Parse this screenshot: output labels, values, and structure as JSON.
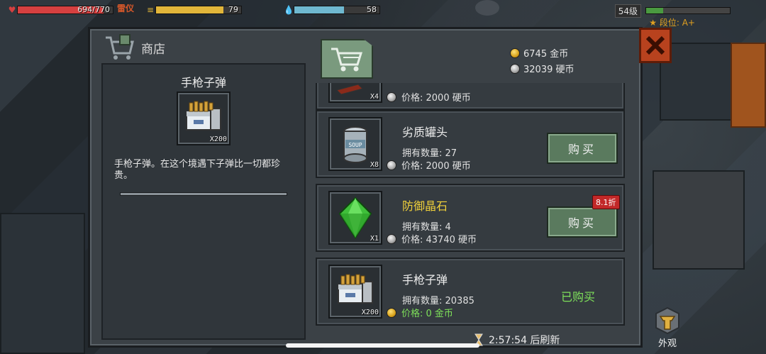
{
  "hud": {
    "hp": {
      "value": "694/770",
      "fraction": 0.9,
      "color": "#d64040"
    },
    "warning": "雷仪",
    "stamina": {
      "value": "79",
      "fraction": 0.79,
      "color": "#e2b63a"
    },
    "water": {
      "value": "58",
      "fraction": 0.58,
      "color": "#6fb8d0"
    },
    "level": "54级",
    "exp_fraction": 0.2,
    "rank": "★ 段位: A+"
  },
  "shop": {
    "title": "商店",
    "gold": "6745 金币",
    "silver": "32039 硬币",
    "refresh": "2:57:54 后刷新"
  },
  "detail": {
    "name": "手枪子弹",
    "qty": "X200",
    "description": "手枪子弹。在这个境遇下子弹比一切都珍贵。"
  },
  "items": [
    {
      "name": "",
      "qty": "X4",
      "own": "",
      "price": "价格: 2000 硬币",
      "coin": "silver",
      "action": "",
      "discount": ""
    },
    {
      "name": "劣质罐头",
      "qty": "X8",
      "own": "拥有数量: 27",
      "price": "价格: 2000 硬币",
      "coin": "silver",
      "action": "购买",
      "discount": ""
    },
    {
      "name": "防御晶石",
      "qty": "X1",
      "own": "拥有数量: 4",
      "price": "价格: 43740 硬币",
      "coin": "silver",
      "action": "购买",
      "discount": "8.1折"
    },
    {
      "name": "手枪子弹",
      "qty": "X200",
      "own": "拥有数量: 20385",
      "price": "价格: 0 金币",
      "coin": "gold",
      "action": "",
      "discount": "",
      "status": "已购买"
    }
  ],
  "appearance_label": "外观"
}
